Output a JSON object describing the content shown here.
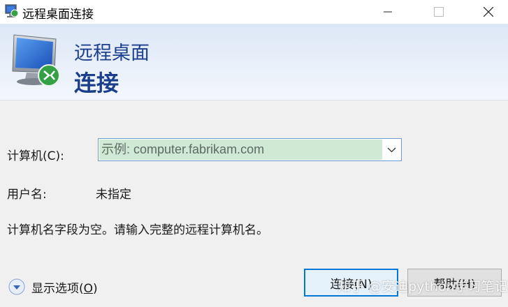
{
  "window": {
    "title": "远程桌面连接",
    "controls": [
      "minimize",
      "maximize",
      "close"
    ]
  },
  "banner": {
    "line1": "远程桌面",
    "line2": "连接",
    "icon": "remote-desktop-monitor-icon"
  },
  "form": {
    "computer_label": "计算机(C):",
    "computer_placeholder": "示例: computer.fabrikam.com",
    "computer_value": "",
    "username_label": "用户名:",
    "username_value": "未指定",
    "message": "计算机名字段为空。请输入完整的远程计算机名。"
  },
  "footer": {
    "options_label": "显示选项(",
    "options_key": "O",
    "options_suffix": ")",
    "connect_label": "连接(N)",
    "help_label": "帮助(H)"
  },
  "watermark": "知乎 @安迪python学习笔记",
  "colors": {
    "banner_text": "#1b3f8c",
    "combo_fill": "#cfe9d5",
    "default_button_border": "#0078d7"
  }
}
